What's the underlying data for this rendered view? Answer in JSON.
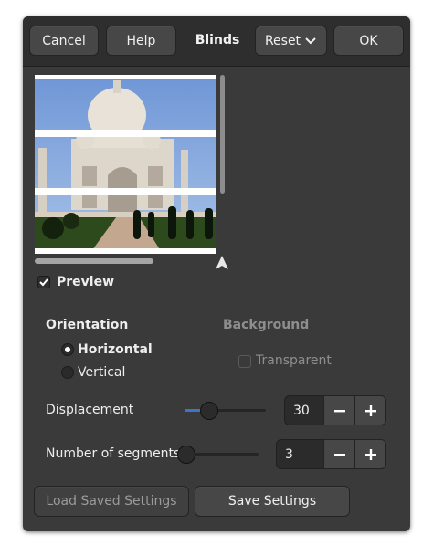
{
  "header": {
    "cancel_label": "Cancel",
    "help_label": "Help",
    "title": "Blinds",
    "reset_label": "Reset",
    "ok_label": "OK"
  },
  "preview": {
    "label": "Preview",
    "checked": true
  },
  "orientation": {
    "heading": "Orientation",
    "options": [
      {
        "label": "Horizontal",
        "selected": true
      },
      {
        "label": "Vertical",
        "selected": false
      }
    ]
  },
  "background": {
    "heading": "Background",
    "transparent_label": "Transparent",
    "transparent_checked": false
  },
  "displacement": {
    "label": "Displacement",
    "value": "30",
    "level": 0.3
  },
  "segments": {
    "label": "Number of segments",
    "value": "3",
    "level": 0.0
  },
  "footer": {
    "load_label": "Load Saved Settings",
    "save_label": "Save Settings"
  },
  "colors": {
    "accent": "#3d74c9",
    "dialog_bg": "#3a3a3a",
    "header_bg": "#2e2e2e"
  }
}
